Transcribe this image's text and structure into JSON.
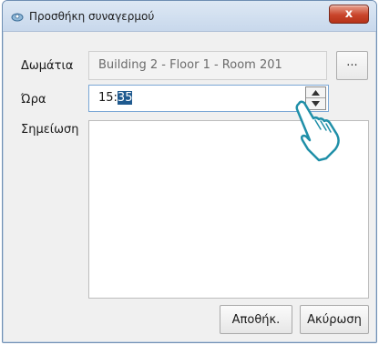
{
  "window": {
    "title": "Προσθήκη συναγερμού",
    "close_label": "x"
  },
  "form": {
    "room_label": "Δωμάτια",
    "room_value": "Building 2 - Floor 1 - Room 201",
    "browse_label": "···",
    "time_label": "Ώρα",
    "time_hours": "15:",
    "time_minutes_selected": "35",
    "note_label": "Σημείωση",
    "note_value": ""
  },
  "buttons": {
    "save_label": "Αποθήκ.",
    "cancel_label": "Ακύρωση"
  },
  "icons": {
    "app": "alarm-app-icon",
    "close": "close-icon",
    "spin_up": "chevron-up-icon",
    "spin_down": "chevron-down-icon",
    "pointer": "hand-pointer-icon"
  },
  "colors": {
    "selection": "#1f5a8f",
    "close_button": "#c9452b",
    "hand_outline": "#1f8fa8"
  }
}
